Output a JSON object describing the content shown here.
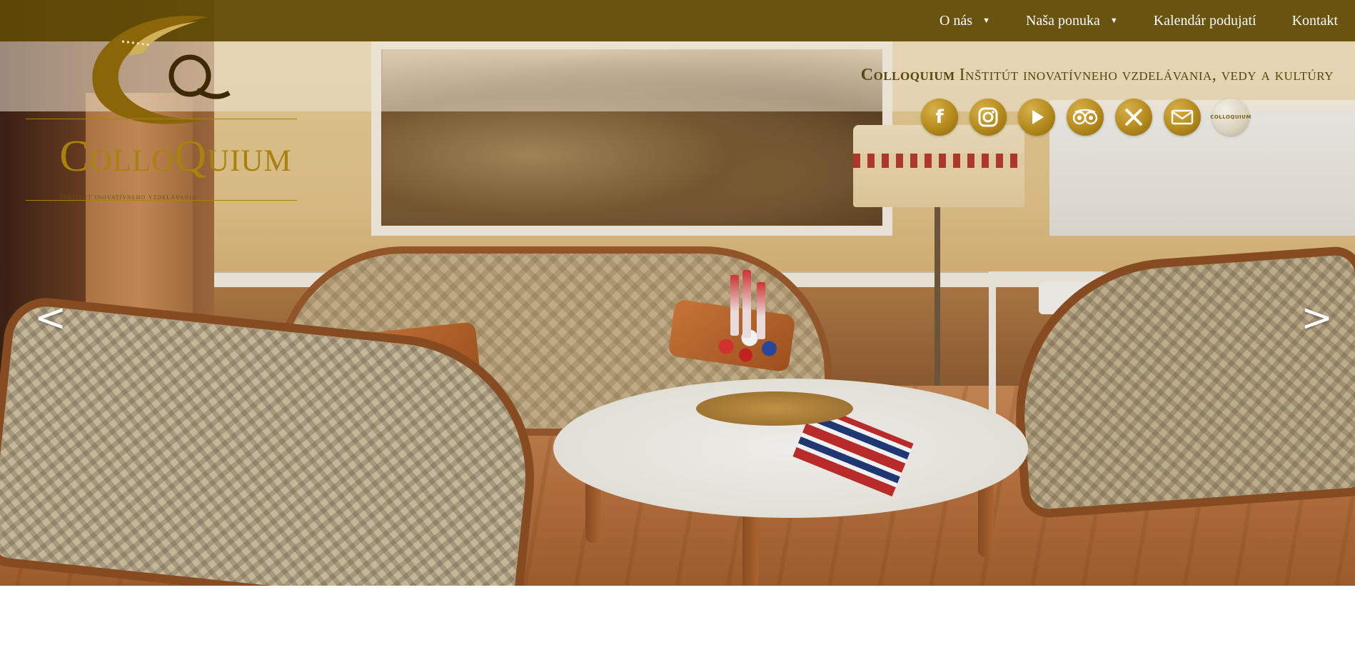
{
  "nav": {
    "items": [
      {
        "label": "O nás",
        "has_dropdown": true
      },
      {
        "label": "Naša ponuka",
        "has_dropdown": true
      },
      {
        "label": "Kalendár podujatí",
        "has_dropdown": false
      },
      {
        "label": "Kontakt",
        "has_dropdown": false
      }
    ],
    "caret": "▼"
  },
  "header": {
    "brand": "Colloquium",
    "tagline": "Inštitút inovatívneho vzdelávania, vedy a kultúry"
  },
  "logo": {
    "title": "ColloQuium",
    "subtitle": "Inštitút inovatívneho vzdelávania"
  },
  "socials": [
    {
      "name": "facebook-icon",
      "glyph": "f"
    },
    {
      "name": "instagram-icon",
      "glyph": ""
    },
    {
      "name": "play-icon",
      "glyph": ""
    },
    {
      "name": "tripadvisor-icon",
      "glyph": ""
    },
    {
      "name": "tools-icon",
      "glyph": ""
    },
    {
      "name": "mail-icon",
      "glyph": ""
    },
    {
      "name": "colloquium-badge-icon",
      "glyph": "COLLOQUIUM"
    }
  ],
  "slider": {
    "prev": "<",
    "next": ">"
  },
  "colors": {
    "topbar": "#604a06",
    "gold": "#a8810f",
    "tagline": "#5a4510"
  }
}
